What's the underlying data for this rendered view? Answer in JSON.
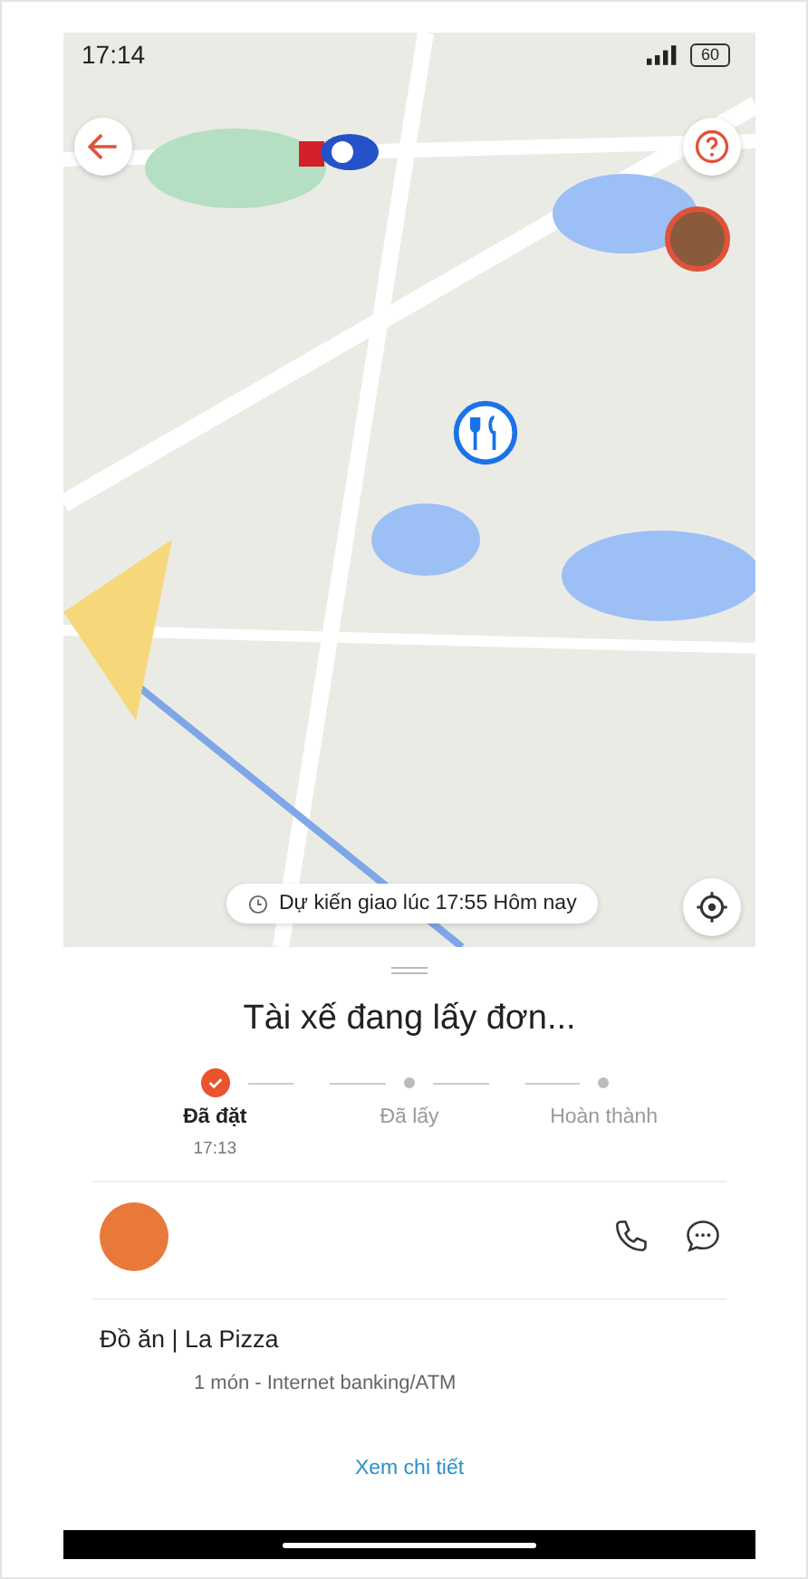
{
  "status_bar": {
    "time": "17:14",
    "battery": "60"
  },
  "map": {
    "eta": "Dự kiến giao lúc 17:55 Hôm nay"
  },
  "order_status": {
    "title": "Tài xế đang lấy đơn...",
    "steps": [
      {
        "label": "Đã đặt",
        "time": "17:13",
        "done": true
      },
      {
        "label": "Đã lấy",
        "done": false
      },
      {
        "label": "Hoàn thành",
        "done": false
      }
    ]
  },
  "order": {
    "title": "Đồ ăn | La Pizza",
    "summary": "1 món  - Internet banking/ATM",
    "details_link": "Xem chi tiết"
  }
}
